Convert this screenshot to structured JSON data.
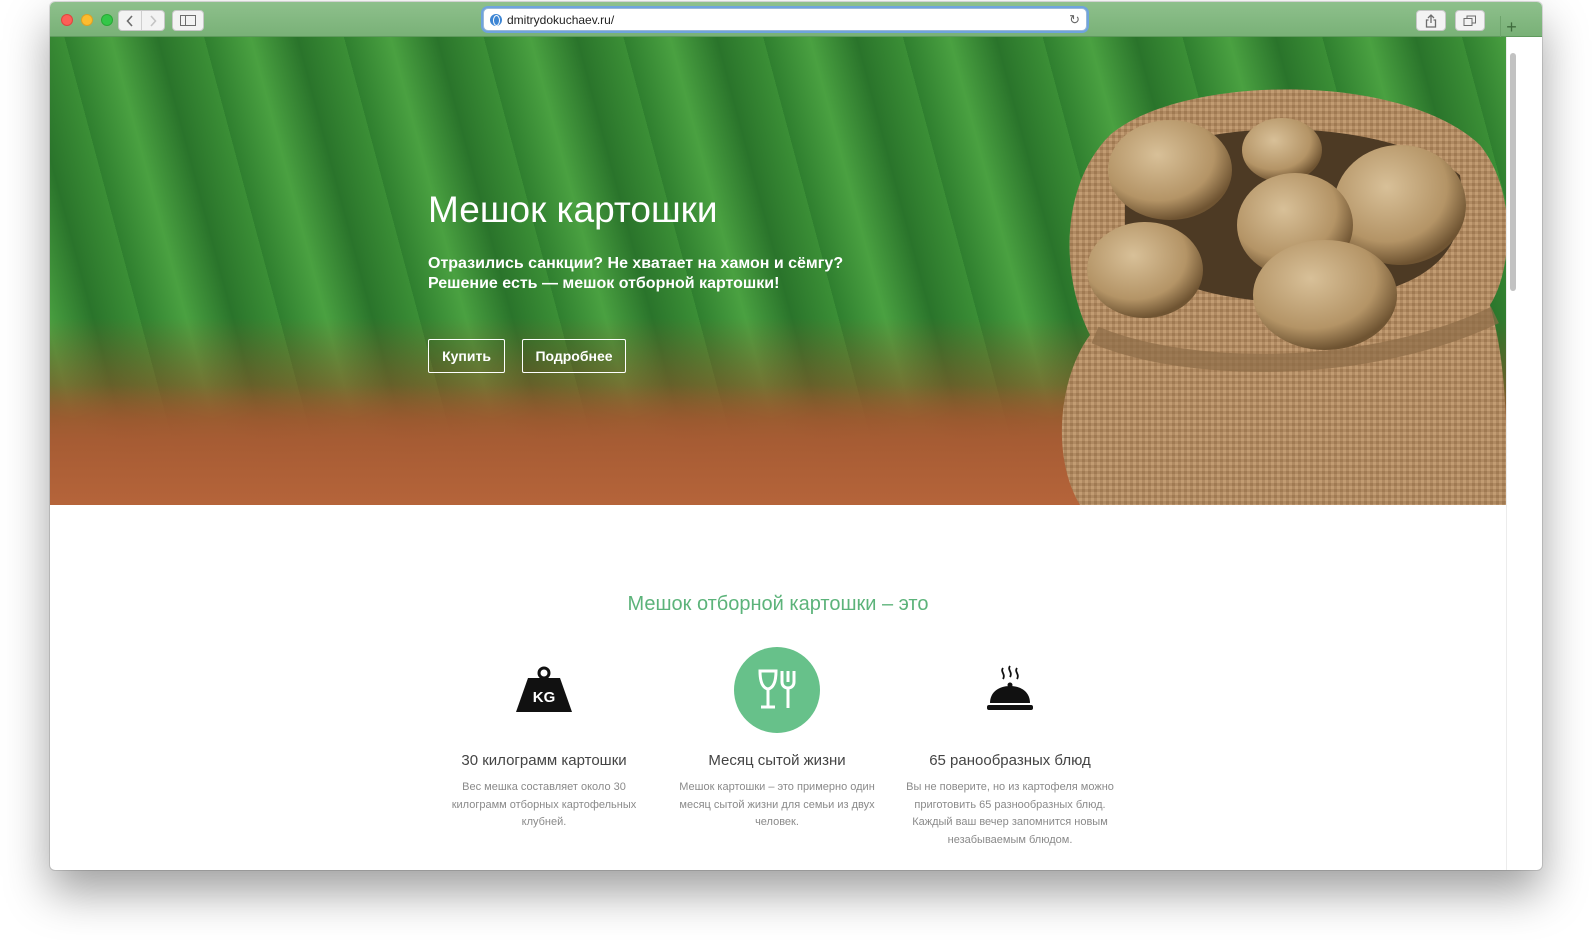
{
  "browser": {
    "url": "dmitrydokuchaev.ru/"
  },
  "hero": {
    "title": "Мешок картошки",
    "subtitle_line1": "Отразились санкции? Не хватает на хамон и сёмгу?",
    "subtitle_line2": "Решение есть — мешок отборной картошки!",
    "buy_label": "Купить",
    "more_label": "Подробнее"
  },
  "features_section": {
    "title": "Мешок отборной картошки – это",
    "items": [
      {
        "icon": "weight-kg-icon",
        "icon_text": "KG",
        "title": "30 килограмм картошки",
        "desc_line1": "Вес мешка составляет около 30",
        "desc_line2": "килограмм отборных картофельных",
        "desc_line3": "клубней."
      },
      {
        "icon": "glass-fork-icon",
        "title": "Месяц сытой жизни",
        "desc_line1": "Мешок картошки – это примерно один",
        "desc_line2": "месяц сытой жизни для семьи из двух",
        "desc_line3": "человек."
      },
      {
        "icon": "serving-dish-icon",
        "title": "65 ранообразных блюд",
        "desc_line1": "Вы не поверите, но из картофеля можно",
        "desc_line2": "приготовить 65 разнообразных блюд.",
        "desc_line3": "Каждый ваш вечер запомнится новым",
        "desc_line4": "незабываемым блюдом."
      }
    ]
  },
  "colors": {
    "accent": "#5cb37a",
    "icon_circle": "#67c18a",
    "toolbar": "#86ba84"
  }
}
